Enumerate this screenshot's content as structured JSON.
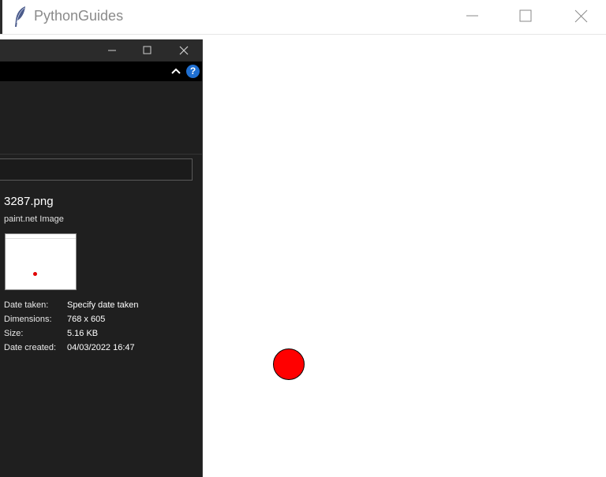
{
  "tk_window": {
    "title": "PythonGuides",
    "icon": "feather-icon",
    "controls": [
      "minimize-icon",
      "maximize-icon",
      "close-icon"
    ],
    "canvas": {
      "background": "#ffffff",
      "shape": {
        "type": "circle",
        "fill": "#ff0000",
        "outline": "#000000"
      }
    }
  },
  "explorer": {
    "theme": "dark",
    "background": "#1f1f1f",
    "help_label": "?",
    "file": {
      "name": "3287.png",
      "type": "paint.net Image"
    },
    "properties": [
      {
        "label": "Date taken:",
        "value": "Specify date taken"
      },
      {
        "label": "Dimensions:",
        "value": "768 x 605"
      },
      {
        "label": "Size:",
        "value": "5.16 KB"
      },
      {
        "label": "Date created:",
        "value": "04/03/2022 16:47"
      }
    ]
  }
}
